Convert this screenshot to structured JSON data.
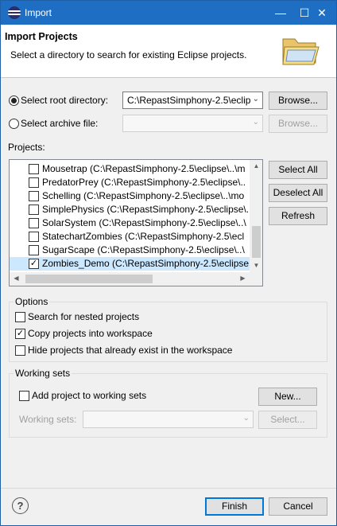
{
  "window": {
    "title": "Import",
    "minimize": "—",
    "maximize": "☐",
    "close": "✕"
  },
  "header": {
    "title": "Import Projects",
    "description": "Select a directory to search for existing Eclipse projects."
  },
  "root_dir": {
    "label": "Select root directory:",
    "value": "C:\\RepastSimphony-2.5\\eclip",
    "browse": "Browse...",
    "selected": true
  },
  "archive": {
    "label": "Select archive file:",
    "value": "",
    "browse": "Browse...",
    "selected": false
  },
  "projects": {
    "label": "Projects:",
    "items": [
      {
        "label": "Mousetrap (C:\\RepastSimphony-2.5\\eclipse\\..\\m",
        "checked": false
      },
      {
        "label": "PredatorPrey (C:\\RepastSimphony-2.5\\eclipse\\..",
        "checked": false
      },
      {
        "label": "Schelling (C:\\RepastSimphony-2.5\\eclipse\\..\\mo",
        "checked": false
      },
      {
        "label": "SimplePhysics (C:\\RepastSimphony-2.5\\eclipse\\..\\",
        "checked": false
      },
      {
        "label": "SolarSystem (C:\\RepastSimphony-2.5\\eclipse\\..\\",
        "checked": false
      },
      {
        "label": "StatechartZombies (C:\\RepastSimphony-2.5\\ecl",
        "checked": false
      },
      {
        "label": "SugarScape (C:\\RepastSimphony-2.5\\eclipse\\..\\",
        "checked": false
      },
      {
        "label": "Zombies_Demo (C:\\RepastSimphony-2.5\\eclipse",
        "checked": true
      }
    ]
  },
  "side_buttons": {
    "select_all": "Select All",
    "deselect_all": "Deselect All",
    "refresh": "Refresh"
  },
  "options": {
    "title": "Options",
    "search_nested": {
      "label": "Search for nested projects",
      "checked": false
    },
    "copy_projects": {
      "label": "Copy projects into workspace",
      "checked": true
    },
    "hide_existing": {
      "label": "Hide projects that already exist in the workspace",
      "checked": false
    }
  },
  "working_sets": {
    "title": "Working sets",
    "add_label": "Add project to working sets",
    "add_checked": false,
    "new_button": "New...",
    "sets_label": "Working sets:",
    "sets_value": "",
    "select_button": "Select..."
  },
  "footer": {
    "help": "?",
    "finish": "Finish",
    "cancel": "Cancel"
  },
  "icons": {
    "app": "eclipse-icon",
    "header": "folder-icon",
    "help": "help-icon",
    "combo": "chevron-down-icon"
  }
}
